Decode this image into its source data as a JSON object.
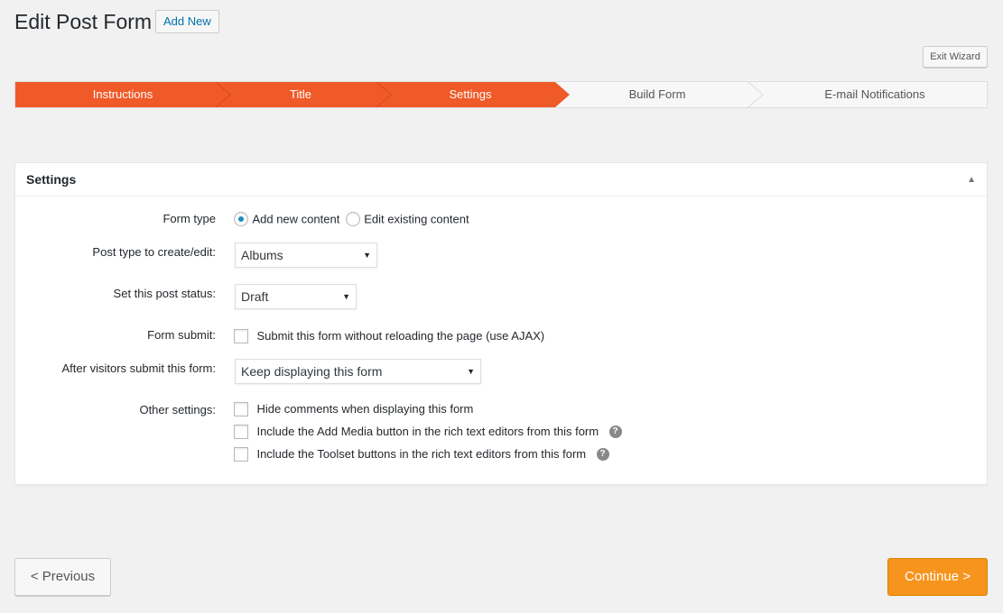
{
  "header": {
    "title": "Edit Post Form",
    "add_new_label": "Add New"
  },
  "exit_wizard_label": "Exit Wizard",
  "wizard": {
    "active_color": "#f05a28",
    "inactive_color": "#f7f7f7",
    "steps": [
      {
        "label": "Instructions",
        "done": true
      },
      {
        "label": "Title",
        "done": true
      },
      {
        "label": "Settings",
        "done": true
      },
      {
        "label": "Build Form",
        "done": false
      },
      {
        "label": "E-mail Notifications",
        "done": false
      }
    ]
  },
  "settings": {
    "title": "Settings",
    "toggle_icon": "triangle-up-icon",
    "form_type": {
      "label": "Form type",
      "options": [
        {
          "label": "Add new content",
          "checked": true
        },
        {
          "label": "Edit existing content",
          "checked": false
        }
      ]
    },
    "post_type": {
      "label": "Post type to create/edit:",
      "value": "Albums"
    },
    "post_status": {
      "label": "Set this post status:",
      "value": "Draft"
    },
    "form_submit": {
      "label": "Form submit:",
      "checkbox_label": "Submit this form without reloading the page (use AJAX)",
      "checked": false
    },
    "after_submit": {
      "label": "After visitors submit this form:",
      "value": "Keep displaying this form"
    },
    "other": {
      "label": "Other settings:",
      "options": [
        {
          "label": "Hide comments when displaying this form",
          "checked": false
        },
        {
          "label": "Include the Add Media button in the rich text editors from this form",
          "checked": false
        },
        {
          "label": "Include the Toolset buttons in the rich text editors from this form",
          "checked": false
        }
      ]
    }
  },
  "footer": {
    "previous_label": "< Previous",
    "continue_label": "Continue >",
    "continue_color": "#f7941d"
  }
}
